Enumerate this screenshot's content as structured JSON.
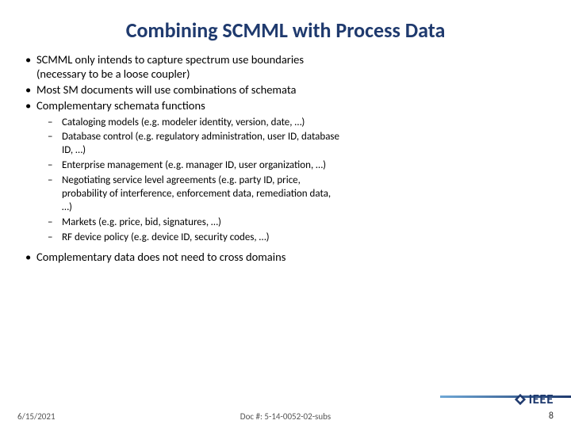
{
  "title": "Combining SCMML with Process Data",
  "bullets_top": [
    "SCMML only intends to capture spectrum use boundaries (necessary to be a loose coupler)",
    "Most SM documents will use combinations of schemata",
    "Complementary schemata functions"
  ],
  "bullets_sub": [
    "Cataloging models (e.g. modeler identity, version, date, …)",
    "Database control (e.g. regulatory administration, user ID, database ID, …)",
    "Enterprise management (e.g. manager ID, user organization, …)",
    "Negotiating service level agreements (e.g. party ID, price, probability of interference, enforcement data, remediation data, …)",
    "Markets (e.g. price, bid, signatures, …)",
    "RF device policy (e.g. device ID, security codes, …)"
  ],
  "bullets_bottom": [
    "Complementary data does not need to cross domains"
  ],
  "footer": {
    "date": "6/15/2021",
    "docnum": "Doc #: 5-14-0052-02-subs",
    "page": "8"
  },
  "logo_text": "IEEE"
}
